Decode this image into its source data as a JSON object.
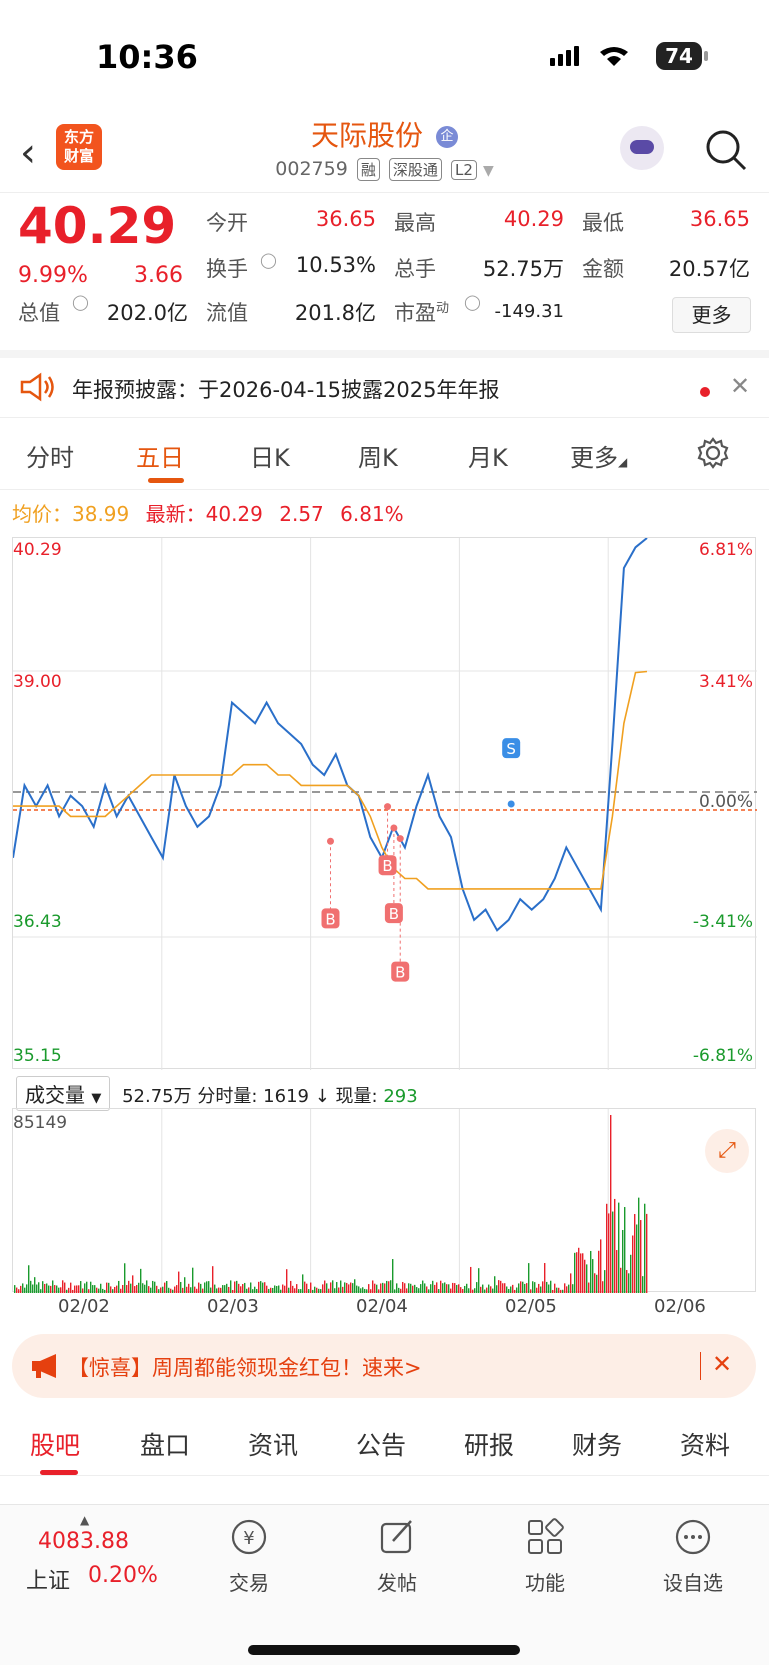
{
  "status": {
    "time": "10:36",
    "battery": "74"
  },
  "header": {
    "logo_line1": "东方",
    "logo_line2": "财富",
    "stock_name": "天际股份",
    "name_badge": "企",
    "code": "002759",
    "tags": [
      "融",
      "深股通",
      "L2"
    ]
  },
  "quote": {
    "price": "40.29",
    "change_pct": "9.99%",
    "change": "3.66",
    "open_label": "今开",
    "open": "36.65",
    "high_label": "最高",
    "high": "40.29",
    "low_label": "最低",
    "low": "36.65",
    "turnover_label": "换手",
    "turnover": "10.53%",
    "volume_label": "总手",
    "volume": "52.75万",
    "amount_label": "金额",
    "amount": "20.57亿",
    "mktcap_label": "总值",
    "mktcap": "202.0亿",
    "float_label": "流值",
    "float": "201.8亿",
    "pe_label": "市盈",
    "pe_sup": "动",
    "pe": "-149.31",
    "more_button": "更多"
  },
  "notice": {
    "text": "年报预披露：于2026-04-15披露2025年年报"
  },
  "chart_tabs": [
    "分时",
    "五日",
    "日K",
    "周K",
    "月K",
    "更多"
  ],
  "chart_info": {
    "avg_label": "均价：",
    "avg": "38.99",
    "latest_label": "最新：",
    "latest": "40.29",
    "latest_chg": "2.57",
    "latest_pct": "6.81%"
  },
  "chart_data": {
    "type": "line",
    "title": "",
    "x_dates": [
      "02/02",
      "02/03",
      "02/04",
      "02/05",
      "02/06"
    ],
    "y_labels_left": [
      "40.29",
      "39.00",
      "36.43",
      "35.15"
    ],
    "y_labels_right": [
      "6.81%",
      "3.41%",
      "0.00%",
      "-3.41%",
      "-6.81%"
    ],
    "ylim": [
      35.15,
      40.29
    ],
    "prev_close": 37.72,
    "avg_price": 38.99,
    "markers": [
      "B",
      "B",
      "B",
      "B",
      "S"
    ],
    "series": [
      {
        "name": "",
        "color": "#2a6fc9",
        "values": [
          37.2,
          37.9,
          37.7,
          37.9,
          37.6,
          37.8,
          37.7,
          37.5,
          37.9,
          37.6,
          37.8,
          37.6,
          37.4,
          37.2,
          38.0,
          37.7,
          37.5,
          37.6,
          37.9,
          38.7,
          38.6,
          38.5,
          38.7,
          38.5,
          38.4,
          38.3,
          38.1,
          38.0,
          38.2,
          37.9,
          37.8,
          37.4,
          37.2,
          37.5,
          37.3,
          37.7,
          38.0,
          37.6,
          37.4,
          36.9,
          36.6,
          36.7,
          36.5,
          36.6,
          36.8,
          36.7,
          36.8,
          37.0,
          37.3,
          37.1,
          36.9,
          36.7,
          38.3,
          40.0,
          40.2,
          40.29
        ]
      },
      {
        "name": "",
        "color": "#f0a020",
        "values": [
          37.7,
          37.7,
          37.7,
          37.7,
          37.7,
          37.6,
          37.6,
          37.6,
          37.6,
          37.7,
          37.8,
          37.9,
          38.0,
          38.0,
          38.0,
          38.0,
          38.0,
          38.0,
          38.0,
          38.0,
          38.1,
          38.1,
          38.1,
          38.0,
          38.0,
          37.9,
          37.9,
          37.9,
          37.9,
          37.9,
          37.8,
          37.6,
          37.3,
          37.1,
          37.0,
          37.0,
          36.9,
          36.9,
          36.9,
          36.9,
          36.9,
          36.9,
          36.9,
          36.9,
          36.9,
          36.9,
          36.9,
          36.9,
          36.9,
          36.9,
          36.9,
          36.9,
          37.6,
          38.5,
          38.99,
          39.0
        ]
      }
    ]
  },
  "volume": {
    "selector": "成交量",
    "total": "52.75万",
    "tick_label": "分时量:",
    "tick": "1619",
    "arrow": "↓",
    "now_label": "现量:",
    "now": "293",
    "max": "85149"
  },
  "banner": {
    "text": "【惊喜】周周都能领现金红包！速来>"
  },
  "bottom_tabs": [
    "股吧",
    "盘口",
    "资讯",
    "公告",
    "研报",
    "财务",
    "资料"
  ],
  "bottom_bar": {
    "index_value": "4083.88",
    "index_name": "上证",
    "index_pct": "0.20%",
    "buttons": [
      "交易",
      "发帖",
      "功能",
      "设自选"
    ]
  },
  "colors": {
    "up": "#e8202a",
    "down": "#1a9a2c",
    "accent": "#e5560f",
    "price_line": "#2a6fc9",
    "avg_line": "#f0a020"
  }
}
